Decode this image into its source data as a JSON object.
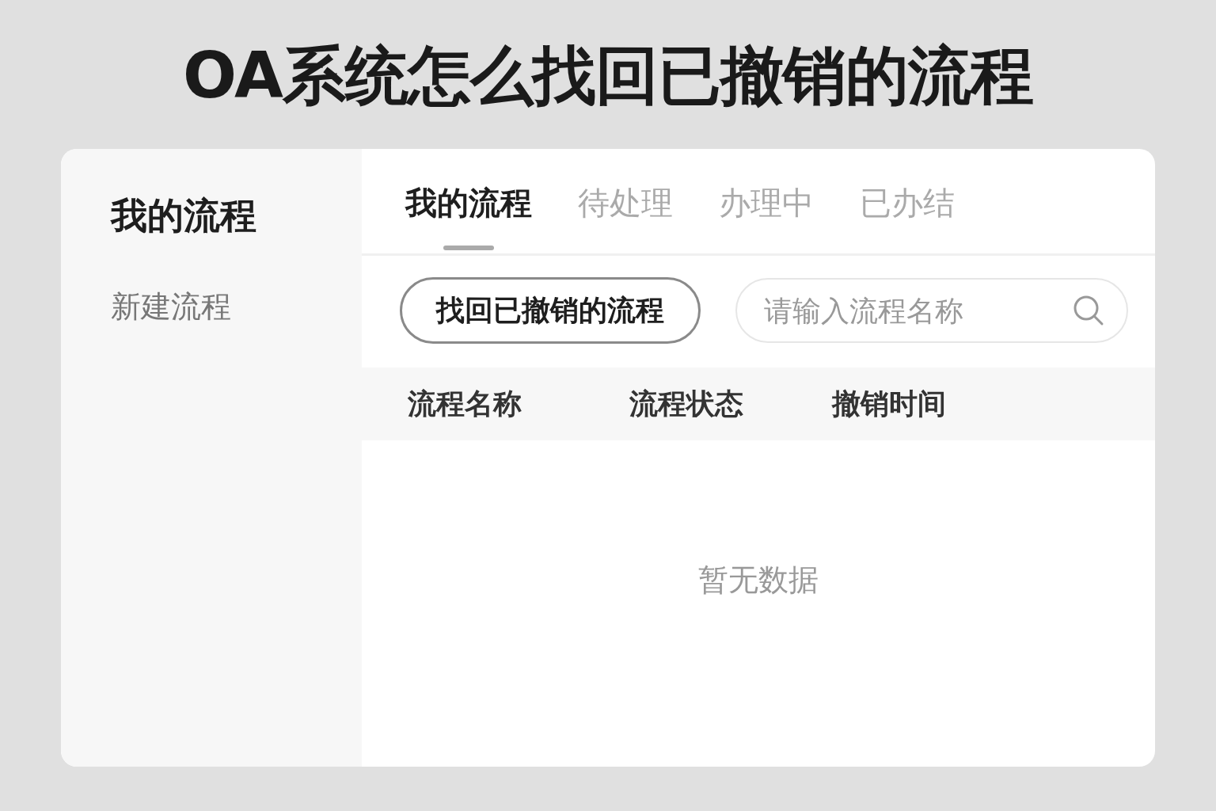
{
  "title": "OA系统怎么找回已撤销的流程",
  "sidebar": {
    "title": "我的流程",
    "items": [
      {
        "label": "新建流程"
      }
    ]
  },
  "tabs": [
    {
      "label": "我的流程",
      "selected": true
    },
    {
      "label": "待处理",
      "selected": false
    },
    {
      "label": "办理中",
      "selected": false
    },
    {
      "label": "已办结",
      "selected": false
    }
  ],
  "action_button": "找回已撤销的流程",
  "search": {
    "placeholder": "请输入流程名称"
  },
  "table": {
    "columns": [
      "流程名称",
      "流程状态",
      "撤销时间"
    ],
    "empty_text": "暂无数据"
  }
}
